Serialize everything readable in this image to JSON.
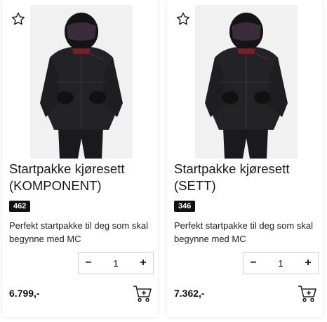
{
  "products": [
    {
      "title": "Startpakke kjøresett (KOMPONENT)",
      "badge": "462",
      "description": "Perfekt startpakke til deg som skal begynne med MC",
      "quantity": "1",
      "price": "6.799,-",
      "decrement_label": "−",
      "increment_label": "+",
      "icons": {
        "favorite": "star-outline-icon",
        "cart": "add-to-cart-icon"
      }
    },
    {
      "title": "Startpakke kjøresett (SETT)",
      "badge": "346",
      "description": "Perfekt startpakke til deg som skal begynne med MC",
      "quantity": "1",
      "price": "7.362,-",
      "decrement_label": "−",
      "increment_label": "+",
      "icons": {
        "favorite": "star-outline-icon",
        "cart": "add-to-cart-icon"
      }
    }
  ],
  "colors": {
    "badge_bg": "#111111",
    "image_bg": "#f1f1f1",
    "jacket": "#1c1c1f"
  }
}
